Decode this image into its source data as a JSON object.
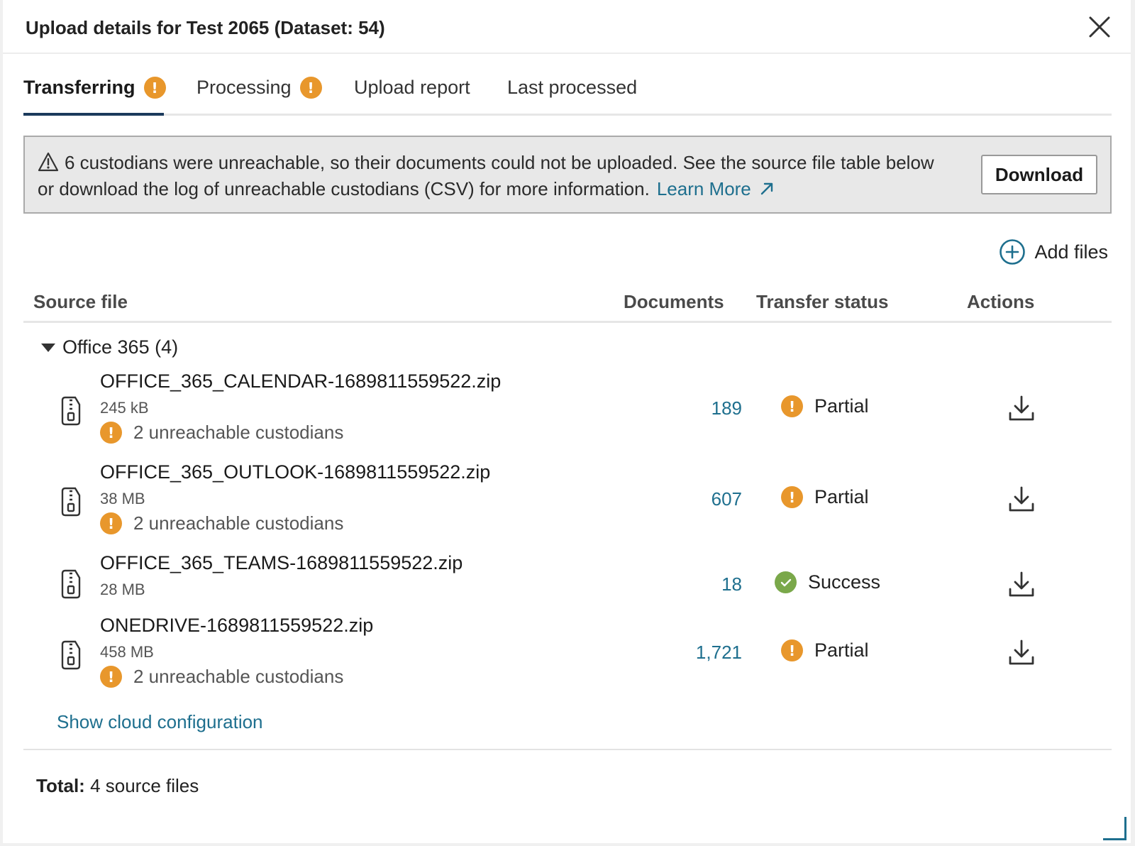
{
  "dialog": {
    "title": "Upload details for Test 2065 (Dataset: 54)"
  },
  "tabs": [
    {
      "label": "Transferring",
      "warning": true,
      "active": true
    },
    {
      "label": "Processing",
      "warning": true,
      "active": false
    },
    {
      "label": "Upload report",
      "warning": false,
      "active": false
    },
    {
      "label": "Last processed",
      "warning": false,
      "active": false
    }
  ],
  "warning_symbol": "!",
  "alert": {
    "message": "6 custodians were unreachable, so their documents could not be uploaded. See the source file table below or download the log of unreachable custodians (CSV) for more information.",
    "link_label": "Learn More",
    "button_label": "Download"
  },
  "add_files_label": "Add files",
  "table": {
    "columns": {
      "source": "Source file",
      "documents": "Documents",
      "status": "Transfer status",
      "actions": "Actions"
    },
    "group_label": "Office 365 (4)",
    "rows": [
      {
        "name": "OFFICE_365_CALENDAR-1689811559522.zip",
        "size": "245 kB",
        "unreachable": "2 unreachable custodians",
        "documents": "189",
        "status": "Partial"
      },
      {
        "name": "OFFICE_365_OUTLOOK-1689811559522.zip",
        "size": "38 MB",
        "unreachable": "2 unreachable custodians",
        "documents": "607",
        "status": "Partial"
      },
      {
        "name": "OFFICE_365_TEAMS-1689811559522.zip",
        "size": "28 MB",
        "unreachable": "",
        "documents": "18",
        "status": "Success"
      },
      {
        "name": "ONEDRIVE-1689811559522.zip",
        "size": "458 MB",
        "unreachable": "2 unreachable custodians",
        "documents": "1,721",
        "status": "Partial"
      }
    ],
    "show_cloud_label": "Show cloud configuration"
  },
  "total": {
    "label": "Total:",
    "value": "4 source files"
  },
  "colors": {
    "accent": "#1e6f8e",
    "warning": "#e8972c",
    "success": "#7aa84a",
    "tab_underline": "#1b3a5c"
  }
}
